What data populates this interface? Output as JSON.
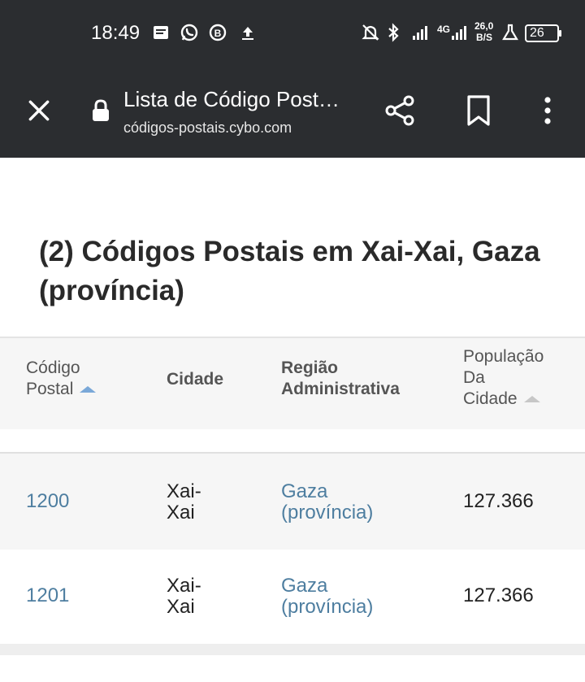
{
  "status_bar": {
    "time": "18:49",
    "network": "4G",
    "speed_value": "26,0",
    "speed_unit": "B/S",
    "battery": "26"
  },
  "browser": {
    "tab_title": "Lista de Código Post…",
    "domain": "códigos-postais.cybo.com"
  },
  "page": {
    "heading": "(2) Códigos Postais em Xai-Xai, Gaza (província)"
  },
  "table": {
    "headers": {
      "postal_line1": "Código",
      "postal_line2": "Postal",
      "city": "Cidade",
      "region_line1": "Região",
      "region_line2": "Administrativa",
      "pop_line1": "População",
      "pop_line2": "Da",
      "pop_line3": "Cidade"
    },
    "rows": [
      {
        "postal": "1200",
        "city_line1": "Xai-",
        "city_line2": "Xai",
        "region_line1": "Gaza",
        "region_line2": "(província)",
        "population": "127.366"
      },
      {
        "postal": "1201",
        "city_line1": "Xai-",
        "city_line2": "Xai",
        "region_line1": "Gaza",
        "region_line2": "(província)",
        "population": "127.366"
      }
    ]
  },
  "colors": {
    "topbar": "#2b2d30",
    "link": "#4e7ea0",
    "sort_active": "#7aa8d8"
  }
}
